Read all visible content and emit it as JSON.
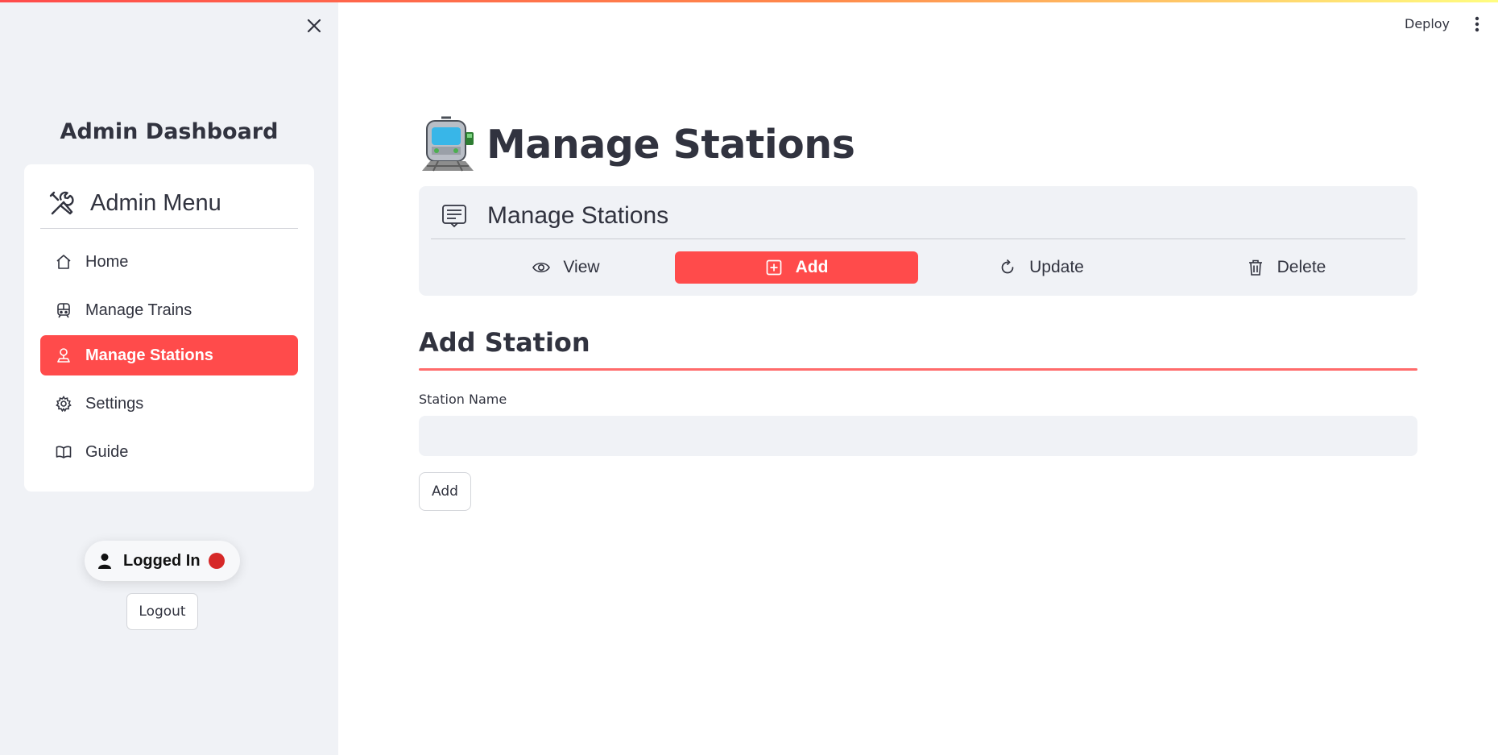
{
  "app": {
    "deploy_label": "Deploy"
  },
  "sidebar": {
    "title": "Admin Dashboard",
    "menu_title": "Admin Menu",
    "items": [
      {
        "label": "Home",
        "icon": "home-icon",
        "active": false
      },
      {
        "label": "Manage Trains",
        "icon": "train-icon",
        "active": false
      },
      {
        "label": "Manage Stations",
        "icon": "map-pin-person-icon",
        "active": true
      },
      {
        "label": "Settings",
        "icon": "gear-icon",
        "active": false
      },
      {
        "label": "Guide",
        "icon": "book-icon",
        "active": false
      }
    ],
    "status_label": "Logged In",
    "status_color": "#d62828",
    "logout_label": "Logout"
  },
  "main": {
    "page_title": "Manage Stations",
    "title_icon": "light-rail-emoji",
    "option_menu": {
      "title": "Manage Stations",
      "tabs": [
        {
          "label": "View",
          "icon": "eye-icon",
          "active": false
        },
        {
          "label": "Add",
          "icon": "plus-square-icon",
          "active": true
        },
        {
          "label": "Update",
          "icon": "refresh-icon",
          "active": false
        },
        {
          "label": "Delete",
          "icon": "trash-icon",
          "active": false
        }
      ]
    },
    "section_title": "Add Station",
    "field_label": "Station Name",
    "field_value": "",
    "submit_label": "Add"
  },
  "colors": {
    "accent": "#ff4b4b",
    "sidebar_bg": "#f0f2f6",
    "text": "#31333f"
  }
}
